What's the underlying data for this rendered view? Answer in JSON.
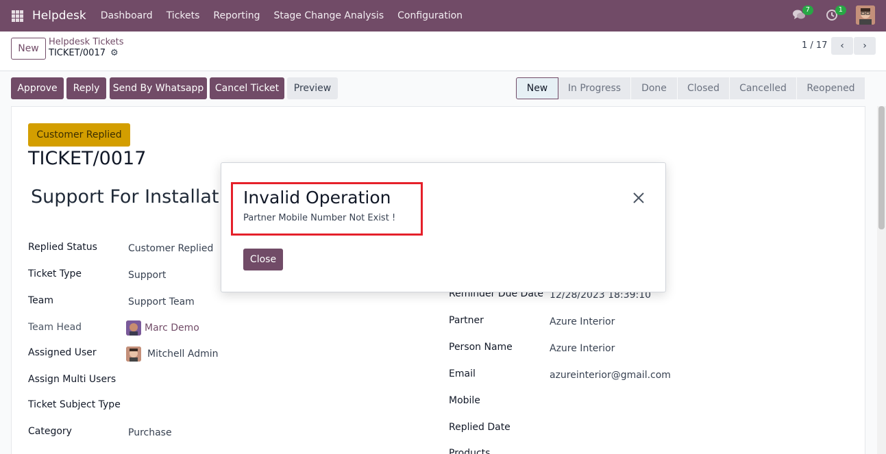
{
  "navbar": {
    "brand": "Helpdesk",
    "menu": [
      "Dashboard",
      "Tickets",
      "Reporting",
      "Stage Change Analysis",
      "Configuration"
    ],
    "chat_count": "7",
    "activity_count": "1",
    "apps_icon": "grid-icon",
    "chat_icon": "chat-bubbles-icon",
    "activity_icon": "clock-icon"
  },
  "control": {
    "new_label": "New",
    "breadcrumb_parent": "Helpdesk Tickets",
    "breadcrumb_current": "TICKET/0017",
    "gear": "⚙",
    "pager": "1 / 17",
    "prev": "‹",
    "next": "›"
  },
  "actions": {
    "approve": "Approve",
    "reply": "Reply",
    "whatsapp": "Send By Whatsapp",
    "cancel": "Cancel Ticket",
    "preview": "Preview"
  },
  "stages": [
    "New",
    "In Progress",
    "Done",
    "Closed",
    "Cancelled",
    "Reopened"
  ],
  "form": {
    "replied_badge": "Customer Replied",
    "ticket_number": "TICKET/0017",
    "subject": "Support For Installatio",
    "left_fields": [
      {
        "label": "Replied Status",
        "value": "Customer Replied"
      },
      {
        "label": "Ticket Type",
        "value": "Support"
      },
      {
        "label": "Team",
        "value": "Support Team"
      },
      {
        "label": "Team Head",
        "value": "Marc Demo"
      },
      {
        "label": "Assigned User",
        "value": "Mitchell Admin"
      },
      {
        "label": "Assign Multi Users",
        "value": ""
      },
      {
        "label": "Ticket Subject Type",
        "value": ""
      },
      {
        "label": "Category",
        "value": "Purchase"
      }
    ],
    "right_fields": [
      {
        "label": "Reminder Due Date",
        "value": "12/28/2023 18:39:10"
      },
      {
        "label": "Partner",
        "value": "Azure Interior"
      },
      {
        "label": "Person Name",
        "value": "Azure Interior"
      },
      {
        "label": "Email",
        "value": "azureinterior@gmail.com"
      },
      {
        "label": "Mobile",
        "value": ""
      },
      {
        "label": "Replied Date",
        "value": ""
      },
      {
        "label": "Products",
        "value": ""
      }
    ]
  },
  "dialog": {
    "title": "Invalid Operation",
    "message": "Partner Mobile Number Not Exist !",
    "close_label": "Close",
    "close_icon": "close-icon"
  },
  "colors": {
    "brand": "#714b67",
    "badge": "#d39e00",
    "highlight": "#e5202a"
  }
}
